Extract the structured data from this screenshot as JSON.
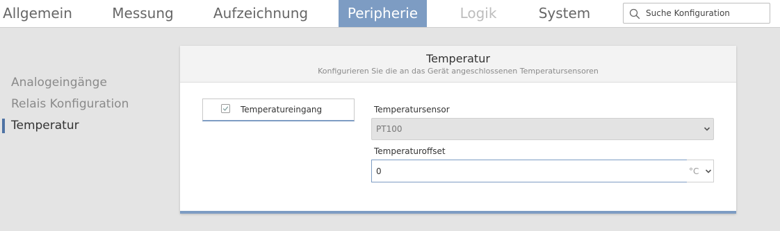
{
  "tabs": [
    {
      "label": "Allgemein",
      "state": "normal"
    },
    {
      "label": "Messung",
      "state": "normal"
    },
    {
      "label": "Aufzeichnung",
      "state": "normal"
    },
    {
      "label": "Peripherie",
      "state": "active"
    },
    {
      "label": "Logik",
      "state": "disabled"
    },
    {
      "label": "System",
      "state": "normal"
    }
  ],
  "search": {
    "placeholder": "Suche Konfiguration",
    "icon": "search-icon"
  },
  "sidebar": {
    "items": [
      {
        "label": "Analogeingänge",
        "active": false
      },
      {
        "label": "Relais Konfiguration",
        "active": false
      },
      {
        "label": "Temperatur",
        "active": true
      }
    ]
  },
  "card": {
    "title": "Temperatur",
    "subtitle": "Konfigurieren Sie die an das Gerät angeschlossenen Temperatursensoren",
    "input_toggle": {
      "label": "Temperatureingang",
      "checked": true
    },
    "sensor": {
      "label": "Temperatursensor",
      "value": "PT100",
      "disabled": true
    },
    "offset": {
      "label": "Temperaturoffset",
      "value": "0",
      "unit": "°C"
    }
  },
  "colors": {
    "accent": "#7d9cc3",
    "side_indicator": "#4f73a4",
    "background": "#e4e4e4",
    "disabled_tab": "#bdbdbd"
  }
}
